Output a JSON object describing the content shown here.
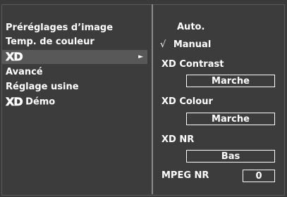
{
  "left_menu": {
    "items": [
      {
        "label": "Préréglages d’image"
      },
      {
        "label": "Temp. de couleur"
      },
      {
        "logo": "XD",
        "arrow": "►"
      },
      {
        "label": "Avancé"
      },
      {
        "label": "Réglage usine"
      },
      {
        "logo": "XD",
        "label": "Démo"
      }
    ]
  },
  "right_panel": {
    "auto_label": "Auto.",
    "manual_check": "√",
    "manual_label": "Manual",
    "xd_contrast_label": "XD Contrast",
    "xd_contrast_value": "Marche",
    "xd_colour_label": "XD Colour",
    "xd_colour_value": "Marche",
    "xd_nr_label": "XD NR",
    "xd_nr_value": "Bas",
    "mpeg_nr_label": "MPEG NR",
    "mpeg_nr_value": "0"
  },
  "colors": {
    "background": "#3a3a3a",
    "selected_row": "#585858",
    "text": "#ffffff"
  }
}
